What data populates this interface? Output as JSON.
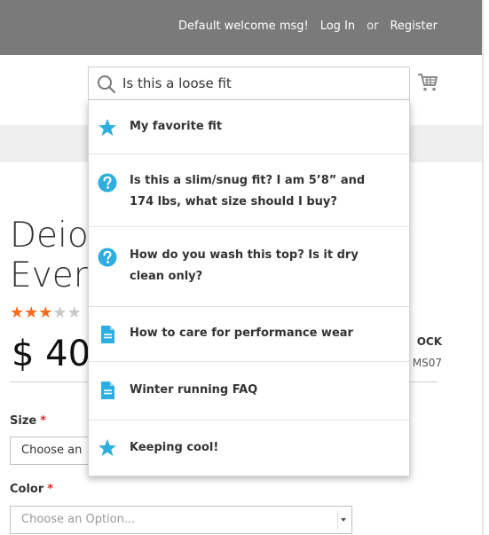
{
  "header": {
    "welcome": "Default welcome msg!",
    "login": "Log In",
    "or": "or",
    "register": "Register"
  },
  "search": {
    "value": "Is this a loose fit",
    "placeholder": ""
  },
  "suggestions": [
    {
      "icon": "star-icon",
      "text": "My favorite fit"
    },
    {
      "icon": "question-icon",
      "text": "Is this a slim/snug fit? I am 5’8” and 174 lbs, what size should I buy?"
    },
    {
      "icon": "question-icon",
      "text": "How do you wash this top? Is it dry clean only?"
    },
    {
      "icon": "document-icon",
      "text": "How to care for performance wear"
    },
    {
      "icon": "document-icon",
      "text": "Winter running FAQ"
    },
    {
      "icon": "star-icon",
      "text": "Keeping cool!"
    }
  ],
  "product": {
    "title_line1": "Deior",
    "title_line2": "EverC",
    "rating_stars": 3.5,
    "price": "$ 40",
    "stock": "OCK",
    "sku": "MS07"
  },
  "options": {
    "size_label": "Size",
    "size_value": "Choose an",
    "color_label": "Color",
    "color_value": "Choose an Option...",
    "required_mark": "*"
  },
  "colors": {
    "accent_blue": "#2eaee0",
    "topbar": "#7a7a7a",
    "star_on": "#f76b1c",
    "required": "#e02b27"
  }
}
